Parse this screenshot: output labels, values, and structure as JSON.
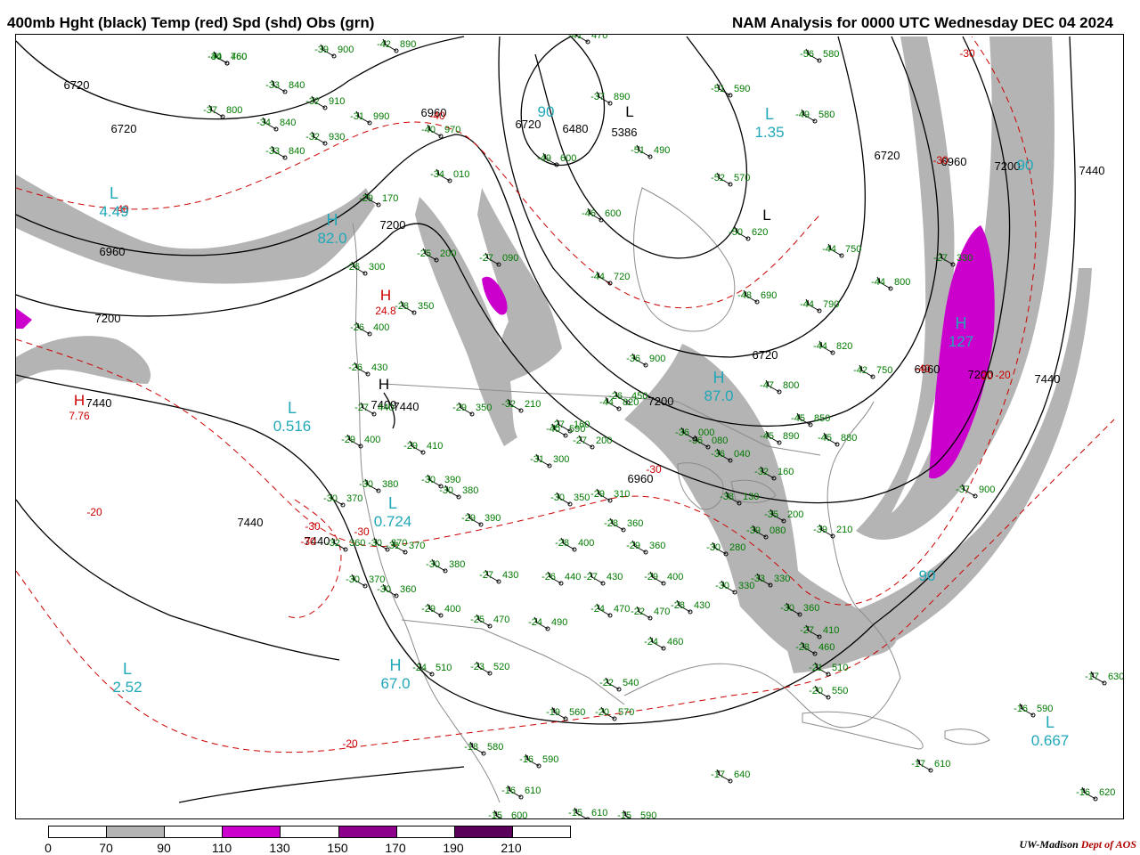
{
  "header": {
    "title_left": "400mb Hght (black) Temp (red) Spd (shd) Obs (grn)",
    "title_right": "NAM Analysis for 0000 UTC Wednesday  DEC 04 2024"
  },
  "colors": {
    "height_contour": "#000000",
    "temperature_contour": "#cc0000",
    "observations": "#007a00",
    "speed_label": "#20a8b8",
    "shade_70": "#b4b4b4",
    "shade_110": "#cc00cc",
    "shade_150": "#8c008c",
    "shade_190": "#5a005a",
    "geography": "#8c8c8c"
  },
  "legend": {
    "boxes": [
      {
        "color": "#ffffff"
      },
      {
        "color": "#b4b4b4"
      },
      {
        "color": "#ffffff"
      },
      {
        "color": "#cc00cc"
      },
      {
        "color": "#ffffff"
      },
      {
        "color": "#8c008c"
      },
      {
        "color": "#ffffff"
      },
      {
        "color": "#5a005a"
      },
      {
        "color": "#ffffff"
      }
    ],
    "labels": [
      "0",
      "70",
      "90",
      "110",
      "130",
      "150",
      "170",
      "190",
      "210"
    ]
  },
  "credit": {
    "institution": "UW-Madison",
    "dept": "Dept of AOS"
  },
  "map": {
    "height_labels": [
      "6720",
      "6720",
      "6960",
      "7200",
      "7440",
      "7440",
      "7200",
      "6960",
      "6720",
      "6480",
      "5386",
      "6720",
      "6960",
      "7200",
      "7440",
      "7440",
      "6960",
      "6720",
      "6960",
      "7200",
      "7440",
      "7440",
      "7200",
      "7409"
    ],
    "temp_labels": [
      "-40",
      "-40",
      "-20",
      "-20",
      "-30",
      "-30",
      "-30",
      "-30",
      "-20",
      "-20",
      "-40",
      "-30",
      "-30"
    ],
    "center_labels": [
      {
        "symbol": "L",
        "value": "4.49"
      },
      {
        "symbol": "H",
        "value": "82.0"
      },
      {
        "symbol": "L",
        "value": "0.516"
      },
      {
        "symbol": "L",
        "value": "0.724"
      },
      {
        "symbol": "L",
        "value": "2.52"
      },
      {
        "symbol": "H",
        "value": "67.0"
      },
      {
        "symbol": "L",
        "value": "1.35"
      },
      {
        "symbol": "H",
        "value": "87.0"
      },
      {
        "symbol": "H",
        "value": "127"
      },
      {
        "symbol": "L",
        "value": "0.667"
      },
      {
        "symbol": "",
        "value": "90"
      },
      {
        "symbol": "",
        "value": "90"
      },
      {
        "symbol": "",
        "value": "90"
      }
    ],
    "pressure_centers": [
      {
        "symbol": "H",
        "value": "24.8"
      },
      {
        "symbol": "H",
        "value": "7.76"
      },
      {
        "symbol": "H",
        "value": ""
      },
      {
        "symbol": "L",
        "value": ""
      },
      {
        "symbol": "L",
        "value": ""
      }
    ],
    "observations": [
      {
        "temp": "-40",
        "height": "760"
      },
      {
        "temp": "-42",
        "height": "890"
      },
      {
        "temp": "-39",
        "height": "900"
      },
      {
        "temp": "-33",
        "height": "840"
      },
      {
        "temp": "-32",
        "height": "910"
      },
      {
        "temp": "-37",
        "height": "800"
      },
      {
        "temp": "-31",
        "height": "990"
      },
      {
        "temp": "-34",
        "height": "840"
      },
      {
        "temp": "-32",
        "height": "930"
      },
      {
        "temp": "-33",
        "height": "840"
      },
      {
        "temp": "-40",
        "height": "970"
      },
      {
        "temp": "-34",
        "height": "010"
      },
      {
        "temp": "-29",
        "height": "170"
      },
      {
        "temp": "-25",
        "height": "200"
      },
      {
        "temp": "-26",
        "height": "300"
      },
      {
        "temp": "-27",
        "height": "090"
      },
      {
        "temp": "-28",
        "height": "350"
      },
      {
        "temp": "-26",
        "height": "400"
      },
      {
        "temp": "-26",
        "height": "430"
      },
      {
        "temp": "-27",
        "height": "440"
      },
      {
        "temp": "-29",
        "height": "400"
      },
      {
        "temp": "-29",
        "height": "410"
      },
      {
        "temp": "-29",
        "height": "350"
      },
      {
        "temp": "-32",
        "height": "210"
      },
      {
        "temp": "-30",
        "height": "380"
      },
      {
        "temp": "-30",
        "height": "390"
      },
      {
        "temp": "-30",
        "height": "380"
      },
      {
        "temp": "-30",
        "height": "370"
      },
      {
        "temp": "-30",
        "height": "370"
      },
      {
        "temp": "-30",
        "height": "360"
      },
      {
        "temp": "-31",
        "height": "370"
      },
      {
        "temp": "-30",
        "height": "380"
      },
      {
        "temp": "-30",
        "height": "370"
      },
      {
        "temp": "-32",
        "height": "360"
      },
      {
        "temp": "-29",
        "height": "400"
      },
      {
        "temp": "-25",
        "height": "470"
      },
      {
        "temp": "-27",
        "height": "430"
      },
      {
        "temp": "-29",
        "height": "390"
      },
      {
        "temp": "-31",
        "height": "300"
      },
      {
        "temp": "-27",
        "height": "160"
      },
      {
        "temp": "-27",
        "height": "200"
      },
      {
        "temp": "-30",
        "height": "350"
      },
      {
        "temp": "-29",
        "height": "310"
      },
      {
        "temp": "-28",
        "height": "360"
      },
      {
        "temp": "-28",
        "height": "400"
      },
      {
        "temp": "-29",
        "height": "360"
      },
      {
        "temp": "-26",
        "height": "440"
      },
      {
        "temp": "-27",
        "height": "430"
      },
      {
        "temp": "-29",
        "height": "400"
      },
      {
        "temp": "-24",
        "height": "470"
      },
      {
        "temp": "-24",
        "height": "490"
      },
      {
        "temp": "-24",
        "height": "510"
      },
      {
        "temp": "-23",
        "height": "520"
      },
      {
        "temp": "-22",
        "height": "540"
      },
      {
        "temp": "-20",
        "height": "570"
      },
      {
        "temp": "-19",
        "height": "560"
      },
      {
        "temp": "-18",
        "height": "580"
      },
      {
        "temp": "-16",
        "height": "590"
      },
      {
        "temp": "-16",
        "height": "610"
      },
      {
        "temp": "-15",
        "height": "600"
      },
      {
        "temp": "-15",
        "height": "610"
      },
      {
        "temp": "-15",
        "height": "590"
      },
      {
        "temp": "-17",
        "height": "640"
      },
      {
        "temp": "-17",
        "height": "610"
      },
      {
        "temp": "-16",
        "height": "620"
      },
      {
        "temp": "-17",
        "height": "630"
      },
      {
        "temp": "-16",
        "height": "590"
      },
      {
        "temp": "-21",
        "height": "510"
      },
      {
        "temp": "-20",
        "height": "550"
      },
      {
        "temp": "-27",
        "height": "410"
      },
      {
        "temp": "-28",
        "height": "460"
      },
      {
        "temp": "-30",
        "height": "360"
      },
      {
        "temp": "-33",
        "height": "330"
      },
      {
        "temp": "-35",
        "height": "200"
      },
      {
        "temp": "-39",
        "height": "080"
      },
      {
        "temp": "-39",
        "height": "210"
      },
      {
        "temp": "-30",
        "height": "330"
      },
      {
        "temp": "-30",
        "height": "280"
      },
      {
        "temp": "-38",
        "height": "130"
      },
      {
        "temp": "-36",
        "height": "040"
      },
      {
        "temp": "-32",
        "height": "160"
      },
      {
        "temp": "-36",
        "height": "080"
      },
      {
        "temp": "-36",
        "height": "000"
      },
      {
        "temp": "-28",
        "height": "430"
      },
      {
        "temp": "-22",
        "height": "470"
      },
      {
        "temp": "-24",
        "height": "460"
      },
      {
        "temp": "-26",
        "height": "450"
      },
      {
        "temp": "-44",
        "height": "720"
      },
      {
        "temp": "-46",
        "height": "600"
      },
      {
        "temp": "-49",
        "height": "600"
      },
      {
        "temp": "-51",
        "height": "490"
      },
      {
        "temp": "-52",
        "height": "570"
      },
      {
        "temp": "-50",
        "height": "620"
      },
      {
        "temp": "-51",
        "height": "590"
      },
      {
        "temp": "-56",
        "height": "580"
      },
      {
        "temp": "-49",
        "height": "580"
      },
      {
        "temp": "-44",
        "height": "750"
      },
      {
        "temp": "-48",
        "height": "690"
      },
      {
        "temp": "-44",
        "height": "790"
      },
      {
        "temp": "-44",
        "height": "820"
      },
      {
        "temp": "-47",
        "height": "800"
      },
      {
        "temp": "-45",
        "height": "850"
      },
      {
        "temp": "-45",
        "height": "880"
      },
      {
        "temp": "-45",
        "height": "890"
      },
      {
        "temp": "-36",
        "height": "900"
      },
      {
        "temp": "-37",
        "height": "900"
      },
      {
        "temp": "-27",
        "height": "330"
      },
      {
        "temp": "-44",
        "height": "800"
      },
      {
        "temp": "-42",
        "height": "750"
      },
      {
        "temp": "-44",
        "height": "820"
      },
      {
        "temp": "-37",
        "height": "890"
      },
      {
        "temp": "-41",
        "height": "470"
      },
      {
        "temp": "-40",
        "height": "590"
      },
      {
        "temp": "-34",
        "height": "460"
      }
    ]
  }
}
